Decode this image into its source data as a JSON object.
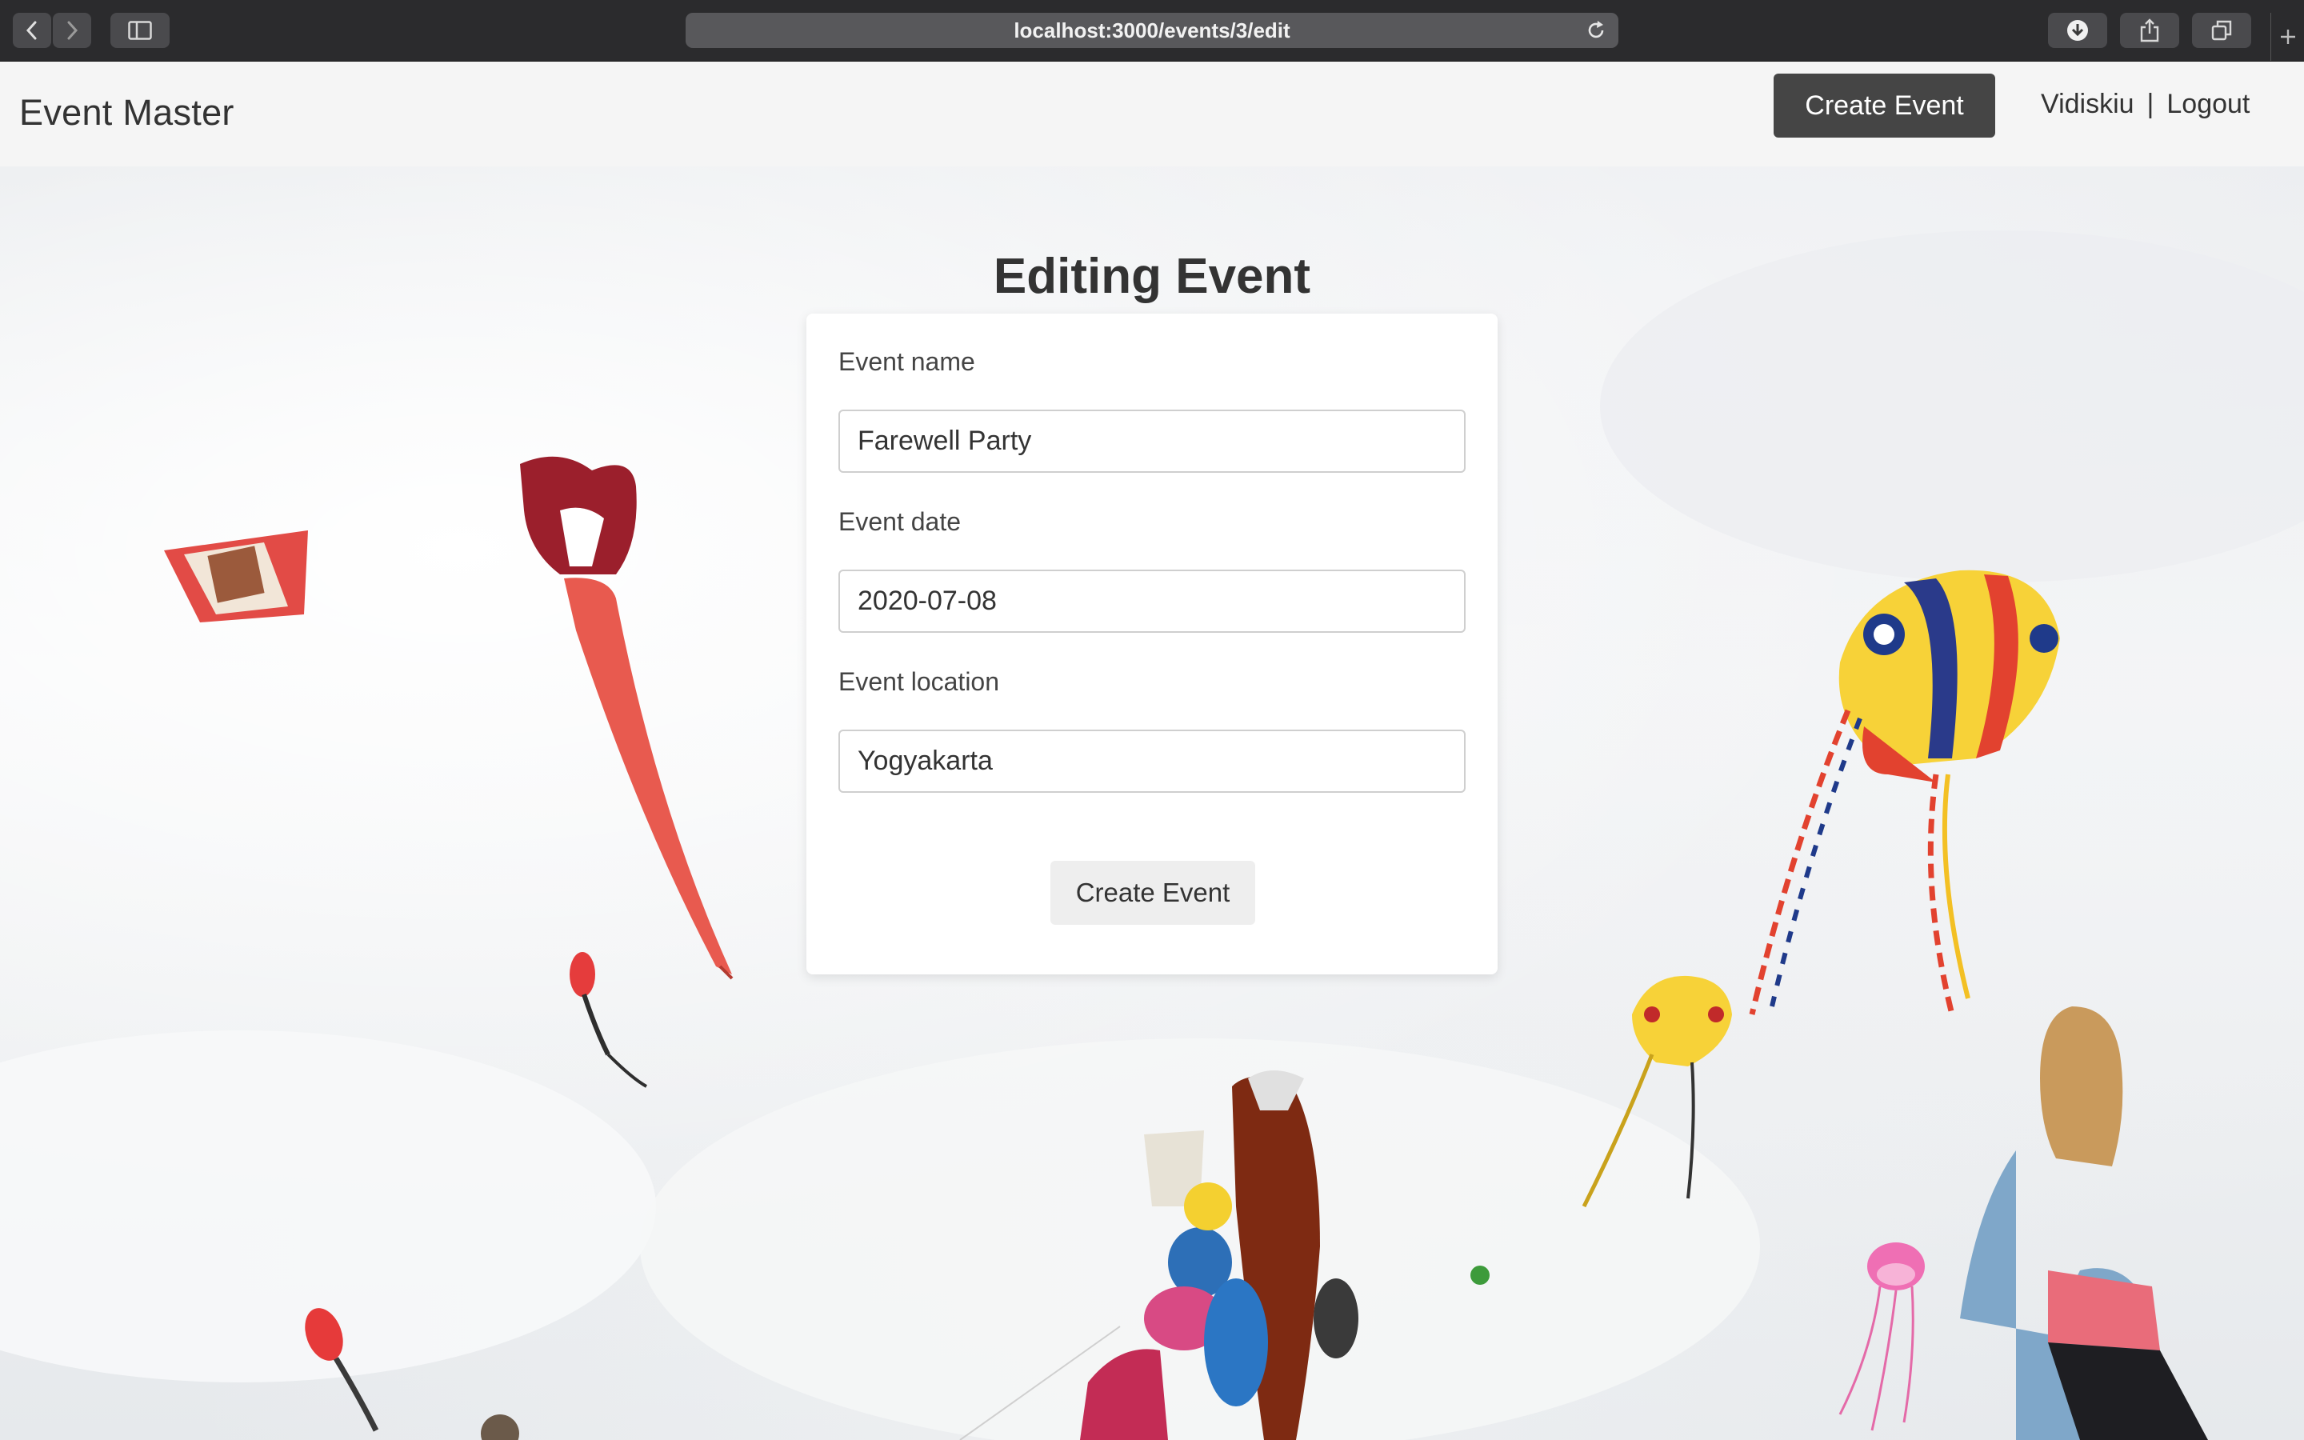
{
  "browser": {
    "url": "localhost:3000/events/3/edit",
    "icons": [
      "back-icon",
      "forward-icon",
      "sidebar-icon",
      "reload-icon",
      "download-icon",
      "share-icon",
      "tabs-icon",
      "new-tab-icon"
    ]
  },
  "navbar": {
    "brand": "Event Master",
    "create_label": "Create Event",
    "username": "Vidiskiu",
    "separator": "|",
    "logout_label": "Logout"
  },
  "page": {
    "title": "Editing Event"
  },
  "form": {
    "name_label": "Event name",
    "name_value": "Farewell Party",
    "date_label": "Event date",
    "date_value": "2020-07-08",
    "location_label": "Event location",
    "location_value": "Yogyakarta",
    "submit_label": "Create Event"
  },
  "colors": {
    "navbar_bg": "#f5f5f5",
    "primary_button": "#454545",
    "secondary_button": "#eeeeee",
    "chrome_bg": "#2b2b2d"
  }
}
